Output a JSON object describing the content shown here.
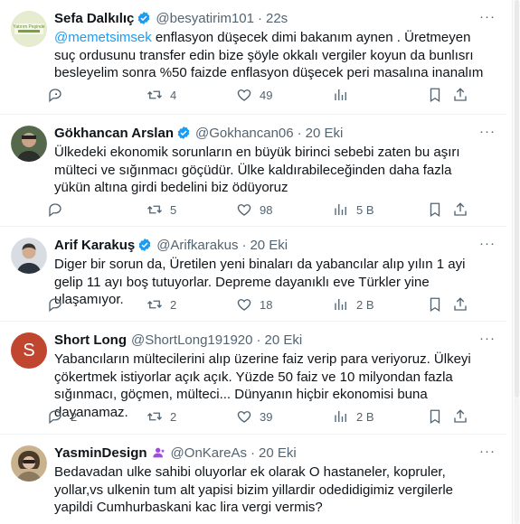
{
  "tweets": [
    {
      "name": "Sefa Dalkılıç",
      "verified": true,
      "badge": "verified",
      "handle": "@besyatirim101",
      "time": "22s",
      "avatar_text": "Yatırım Peşinde",
      "avatar_color": "#dfe7c8",
      "mention": "@memetsimsek",
      "text": " enflasyon düşecek dimi bakanım aynen . Üretmeyen suç ordusunu transfer edin bize şöyle okkalı vergiler koyun da bunlısrı besleyelim sonra %50 faizde enflasyon düşecek peri masalına inanalım .",
      "reply": "",
      "retweets": "4",
      "likes": "49",
      "views": ""
    },
    {
      "name": "Gökhancan Arslan",
      "verified": true,
      "badge": "verified",
      "handle": "@Gokhancan06",
      "time": "20 Eki",
      "avatar_color": "#3e4d3a",
      "mention": "",
      "text": "Ülkedeki ekonomik sorunların en büyük birinci sebebi zaten bu aşırı mülteci ve sığınmacı göçüdür. Ülke kaldırabileceğinden daha fazla yükün altına girdi bedelini biz ödüyoruz",
      "reply": "",
      "retweets": "5",
      "likes": "98",
      "views": "5 B"
    },
    {
      "name": "Arif Karakuş",
      "verified": true,
      "badge": "verified",
      "handle": "@Arifkarakus",
      "time": "20 Eki",
      "avatar_color": "#cfd6dc",
      "mention": "",
      "text": "Diger bir sorun da, Üretilen yeni binaları da yabancılar alıp yılın 1 ayi gelip 11 ayı boş tutuyorlar. Depreme dayanıklı eve Türkler yine ulaşamıyor.",
      "reply": "",
      "retweets": "2",
      "likes": "18",
      "views": "2 B"
    },
    {
      "name": "Short Long",
      "verified": false,
      "badge": "",
      "handle": "@ShortLong191920",
      "time": "20 Eki",
      "avatar_text": "S",
      "avatar_color": "#c0462f",
      "mention": "",
      "text": "Yabancıların mültecilerini alıp üzerine faiz verip para veriyoruz. Ülkeyi çökertmek istiyorlar açık açık. Yüzde 50 faiz ve 10 milyondan fazla sığınmacı, göçmen, mülteci... Dünyanın hiçbir ekonomisi buna dayanamaz.",
      "reply": "2",
      "retweets": "2",
      "likes": "39",
      "views": "2 B"
    },
    {
      "name": "YasminDesign",
      "verified": false,
      "badge": "purple-person",
      "handle": "@OnKareAs",
      "time": "20 Eki",
      "avatar_color": "#b9a27c",
      "mention": "",
      "text": "Bedavadan ulke sahibi oluyorlar ek olarak O hastaneler, kopruler, yollar,vs ulkenin tum alt yapisi bizim yillardir odedidigimiz vergilerle yapildi Cumhurbaskani kac lira vergi vermis?",
      "reply": "",
      "retweets": "",
      "likes": "",
      "views": ""
    }
  ],
  "colors": {
    "accent": "#1d9bf0",
    "muted": "#536471",
    "text": "#0f1419",
    "purple": "#9d4edd"
  }
}
